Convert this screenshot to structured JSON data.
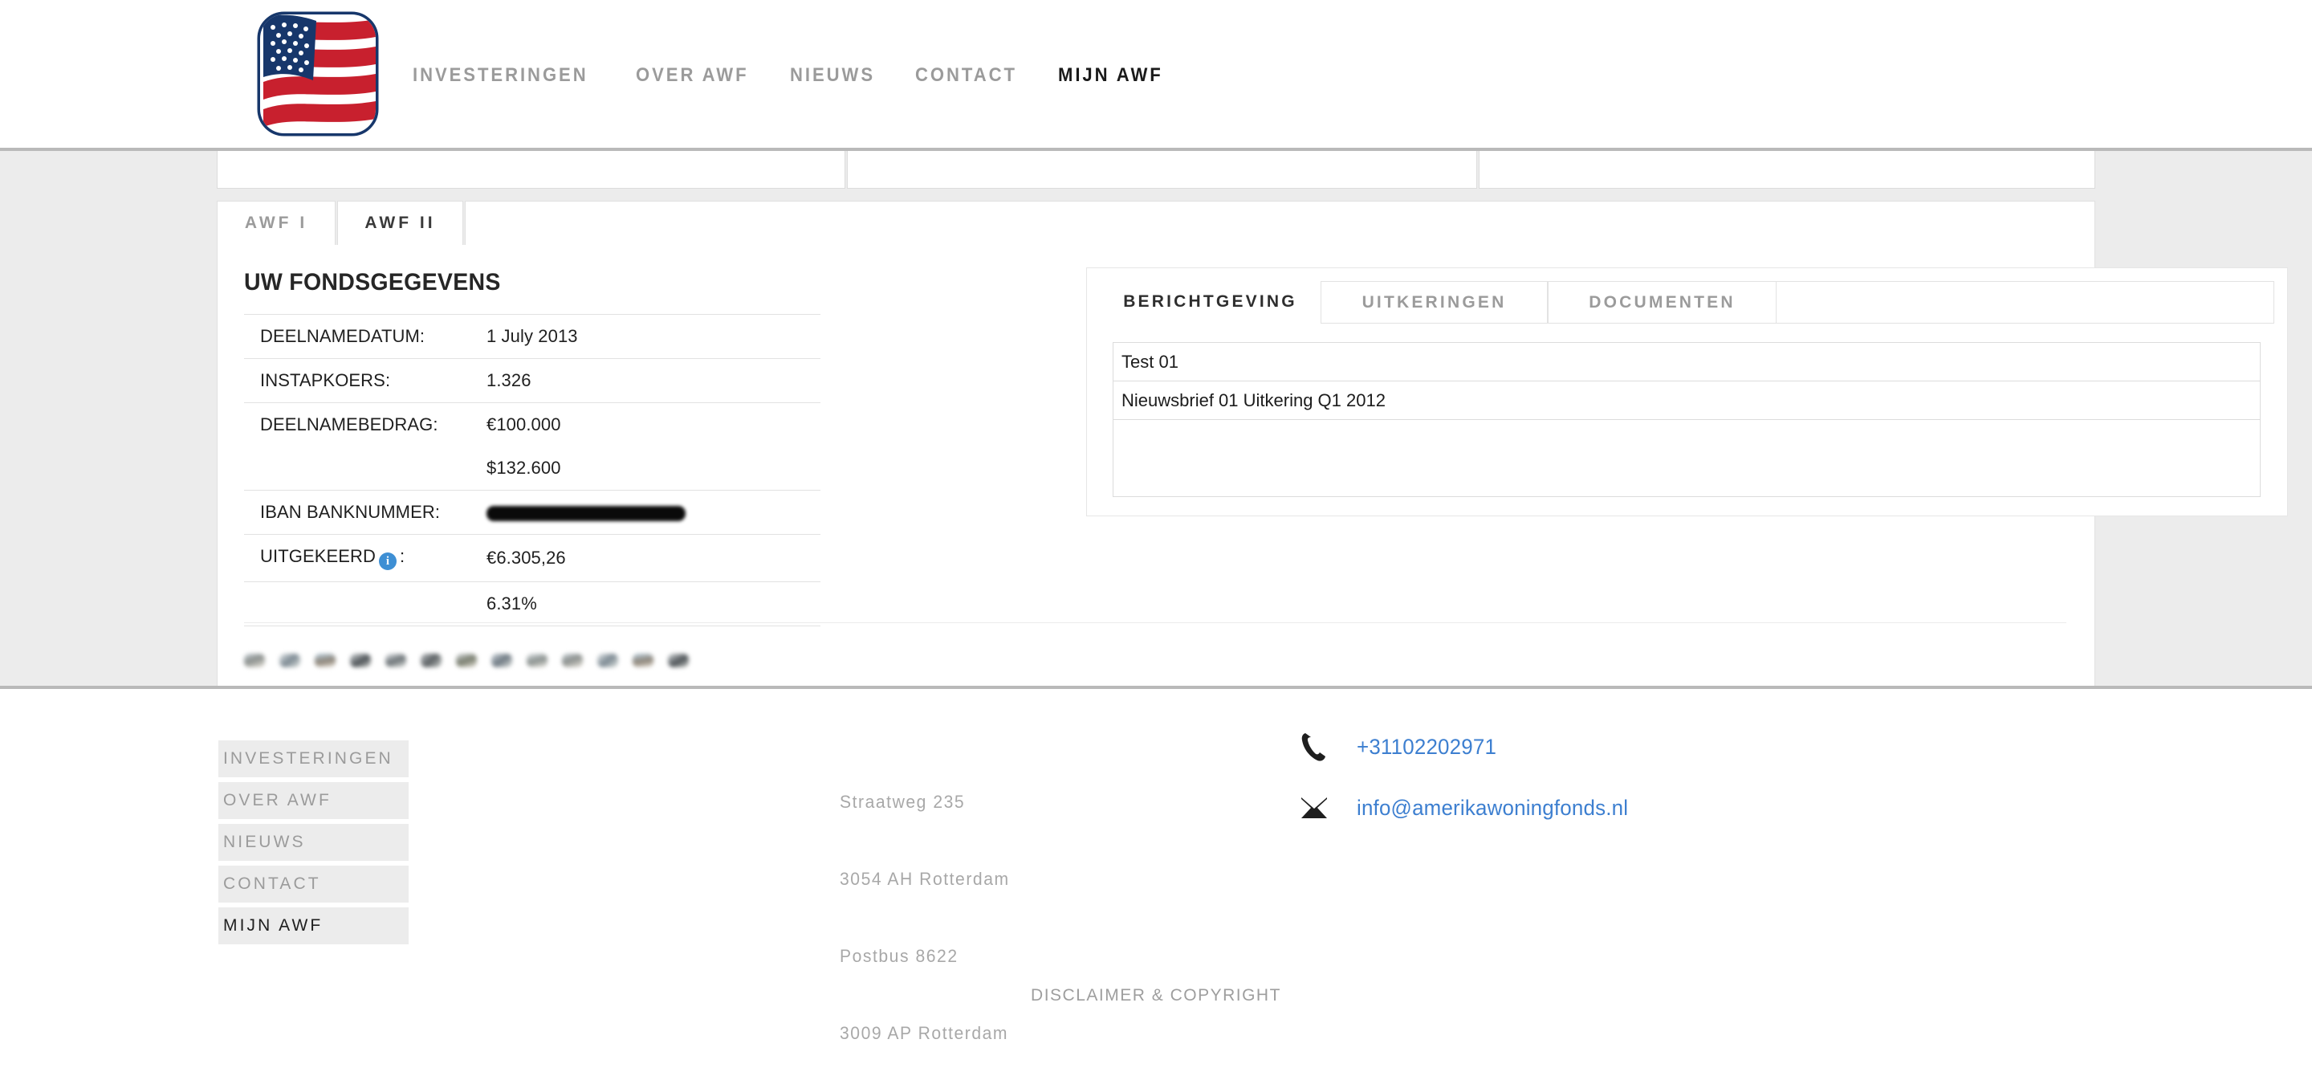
{
  "header": {
    "logo_alt": "us-flag-logo",
    "nav": [
      {
        "label": "INVESTERINGEN",
        "active": false
      },
      {
        "label": "OVER AWF",
        "active": false
      },
      {
        "label": "NIEUWS",
        "active": false
      },
      {
        "label": "CONTACT",
        "active": false
      },
      {
        "label": "MIJN AWF",
        "active": true
      }
    ]
  },
  "fund_tabs": [
    {
      "label": "AWF I",
      "active": false
    },
    {
      "label": "AWF II",
      "active": true
    }
  ],
  "fund": {
    "title": "UW FONDSGEGEVENS",
    "rows": [
      {
        "key": "DEELNAMEDATUM:",
        "value": "1 July 2013",
        "type": "text"
      },
      {
        "key": "INSTAPKOERS:",
        "value": "1.326",
        "type": "text"
      },
      {
        "key": "DEELNAMEBEDRAG:",
        "value": "€100.000",
        "type": "text"
      },
      {
        "key": "",
        "value": "$132.600",
        "type": "text"
      },
      {
        "key": "IBAN BANKNUMMER:",
        "value": "",
        "type": "redacted"
      },
      {
        "key": "UITGEKEERD",
        "key_suffix": ":",
        "value": "€6.305,26",
        "type": "info"
      },
      {
        "key": "",
        "value": "6.31%",
        "type": "text"
      }
    ]
  },
  "messages": {
    "tabs": [
      {
        "label": "BERICHTGEVING",
        "active": true
      },
      {
        "label": "UITKERINGEN",
        "active": false
      },
      {
        "label": "DOCUMENTEN",
        "active": false
      }
    ],
    "items": [
      {
        "label": "Test 01"
      },
      {
        "label": "Nieuwsbrief 01 Uitkering Q1 2012"
      }
    ]
  },
  "thumbnails": {
    "count": 13,
    "alt": "property-thumbnail"
  },
  "footer": {
    "nav": [
      {
        "label": "INVESTERINGEN",
        "active": false
      },
      {
        "label": "OVER AWF",
        "active": false
      },
      {
        "label": "NIEUWS",
        "active": false
      },
      {
        "label": "CONTACT",
        "active": false
      },
      {
        "label": "MIJN AWF",
        "active": true
      }
    ],
    "address": {
      "line1": "Straatweg 235",
      "line2": "3054 AH Rotterdam",
      "line3": "Postbus 8622",
      "line4": "3009 AP Rotterdam"
    },
    "phone": "+31102202971",
    "email": "info@amerikawoningfonds.nl",
    "disclaimer": "DISCLAIMER & COPYRIGHT"
  },
  "colors": {
    "accent_link": "#3d7fd0",
    "info_badge": "#3e8fd4",
    "muted_text": "#9b9b9b",
    "page_bg": "#ececec"
  }
}
